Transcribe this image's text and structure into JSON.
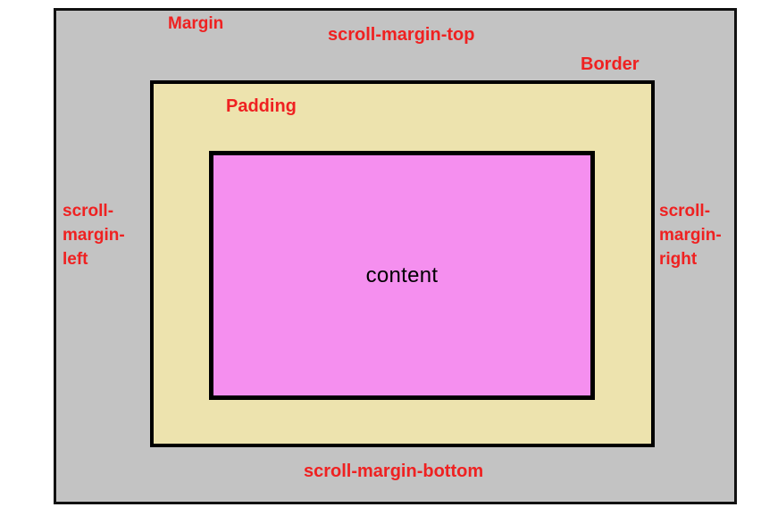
{
  "diagram": {
    "title": "CSS scroll-margin box model diagram",
    "colors": {
      "margin_fill": "#c3c3c3",
      "padding_fill": "#ede3ae",
      "content_fill": "#f58fef",
      "border_stroke": "#000000",
      "label_red": "#ef2121",
      "content_text": "#000000",
      "page_background": "#ffffff"
    },
    "labels": {
      "margin": "Margin",
      "scroll_margin_top": "scroll-margin-top",
      "border": "Border",
      "padding": "Padding",
      "scroll_margin_left": "scroll-margin-left",
      "scroll_margin_right": "scroll-margin-right",
      "scroll_margin_bottom": "scroll-margin-bottom",
      "content": "content"
    }
  }
}
